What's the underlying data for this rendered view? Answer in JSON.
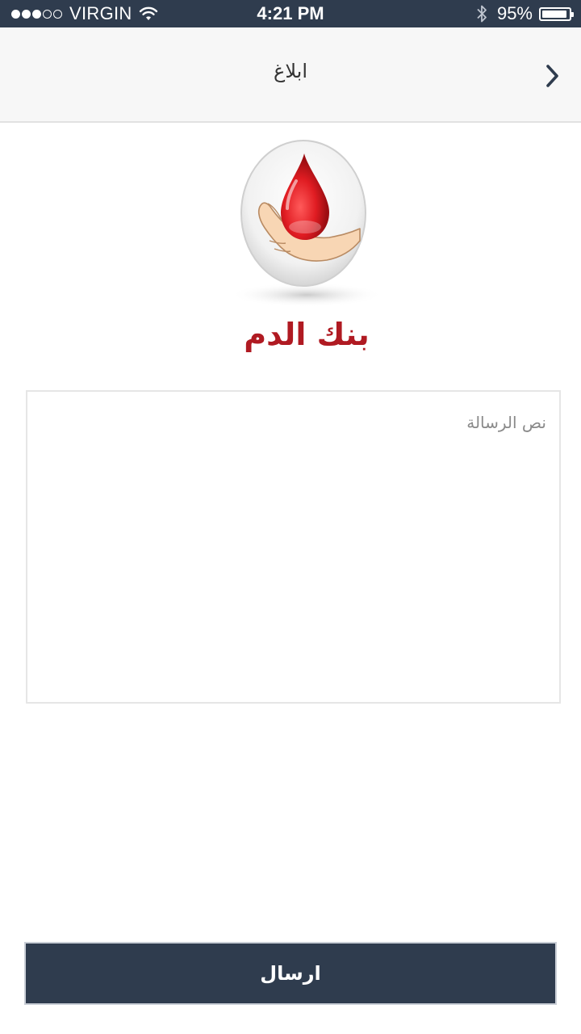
{
  "status_bar": {
    "signal_dots_filled": 3,
    "signal_dots_empty": 2,
    "carrier": "VIRGIN",
    "time": "4:21 PM",
    "battery_percent_text": "95%",
    "battery_level": 0.95
  },
  "nav": {
    "title": "ابلاغ",
    "back_icon": "chevron-right-icon"
  },
  "logo": {
    "name": "بنك الدم",
    "icon": "blood-drop-hand-icon"
  },
  "message": {
    "placeholder": "نص الرسالة",
    "value": ""
  },
  "send_button": {
    "label": "ارسال"
  },
  "colors": {
    "status_bar_bg": "#2f3c4e",
    "nav_bg": "#f7f7f7",
    "brand_red": "#b01a22",
    "button_bg": "#2f3c4e",
    "button_text": "#ffffff"
  }
}
